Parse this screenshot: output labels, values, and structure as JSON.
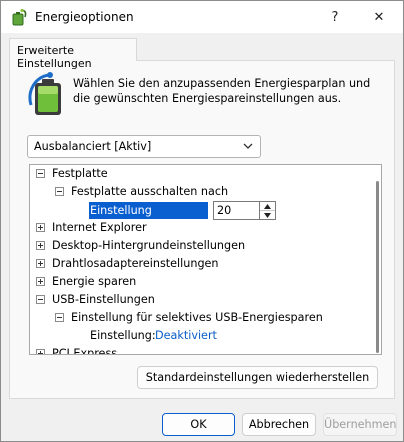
{
  "window": {
    "title": "Energieoptionen",
    "help_glyph": "?",
    "close_glyph": "✕"
  },
  "tab": {
    "label": "Erweiterte Einstellungen"
  },
  "intro": {
    "text": "Wählen Sie den anzupassenden Energiesparplan und die gewünschten Energiespareinstellungen aus."
  },
  "plan_select": {
    "value": "Ausbalanciert [Aktiv]"
  },
  "tree": {
    "festplatte": "Festplatte",
    "festplatte_ausschalten": "Festplatte ausschalten nach",
    "einstellung_minuten": "Einstellung (Minuten):",
    "minuten_value": "20",
    "internet_explorer": "Internet Explorer",
    "desktop_hintergrund": "Desktop-Hintergrundeinstellungen",
    "drahtlosadapter": "Drahtlosadaptereinstellungen",
    "energie_sparen": "Energie sparen",
    "usb_einstellungen": "USB-Einstellungen",
    "usb_selektiv": "Einstellung für selektives USB-Energiesparen",
    "einstellung_label": "Einstellung:",
    "einstellung_value": "Deaktiviert",
    "pci_express": "PCI Express"
  },
  "buttons": {
    "restore": "Standardeinstellungen wiederherstellen",
    "ok": "OK",
    "cancel": "Abbrechen",
    "apply": "Übernehmen"
  },
  "colors": {
    "selection": "#0a5fd0",
    "link": "#0b5fc7",
    "disabled_text": "#9e9e9e"
  },
  "icons": {
    "app": "power-options-icon",
    "battery": "battery-plan-icon",
    "dropdown": "chevron-down-icon"
  }
}
